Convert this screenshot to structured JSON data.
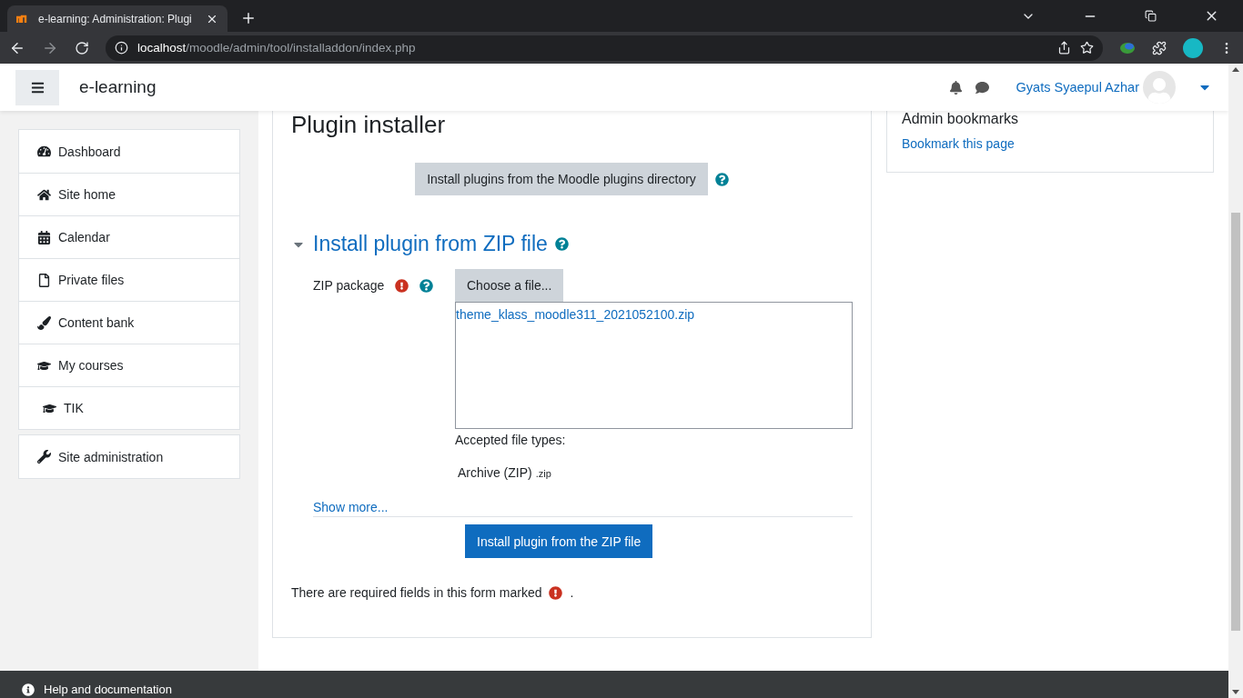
{
  "browser": {
    "tab_title": "e-learning: Administration: Plugi",
    "url_host": "localhost",
    "url_path": "/moodle/admin/tool/installaddon/index.php"
  },
  "header": {
    "site_name": "e-learning",
    "user_name": "Gyats Syaepul Azhar"
  },
  "nav": [
    {
      "label": "Dashboard",
      "kind": "dashboard"
    },
    {
      "label": "Site home",
      "kind": "home"
    },
    {
      "label": "Calendar",
      "kind": "calendar"
    },
    {
      "label": "Private files",
      "kind": "file"
    },
    {
      "label": "Content bank",
      "kind": "brush"
    },
    {
      "label": "My courses",
      "kind": "courses"
    },
    {
      "label": "TIK",
      "kind": "course"
    }
  ],
  "nav_admin": [
    {
      "label": "Site administration",
      "kind": "wrench"
    }
  ],
  "main": {
    "title": "Plugin installer",
    "directory_button": "Install plugins from the Moodle plugins directory",
    "section": {
      "title": "Install plugin from ZIP file",
      "expanded": true
    },
    "field": {
      "label": "ZIP package",
      "required": true,
      "choose_button": "Choose a file...",
      "file": "theme_klass_moodle311_2021052100.zip",
      "accepted_label": "Accepted file types:",
      "accepted_type": "Archive (ZIP)",
      "accepted_ext": ".zip"
    },
    "show_more": "Show more...",
    "submit": "Install plugin from the ZIP file",
    "required_note": "There are required fields in this form marked",
    "required_note_end": "."
  },
  "block": {
    "title": "Admin bookmarks",
    "link": "Bookmark this page"
  },
  "footer": {
    "help": "Help and documentation"
  }
}
